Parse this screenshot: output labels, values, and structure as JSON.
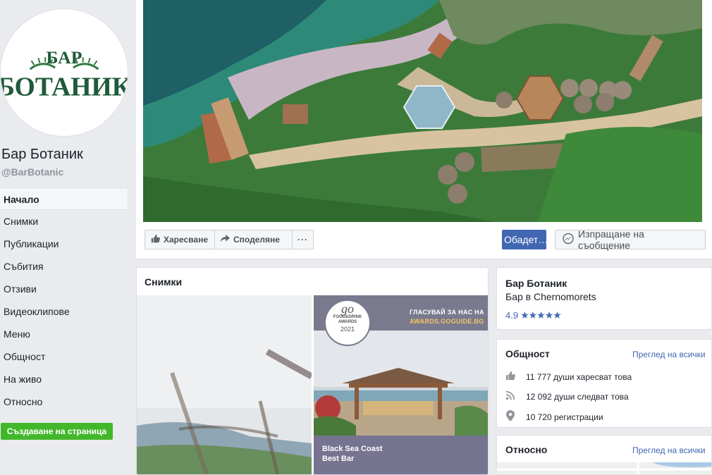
{
  "page": {
    "name": "Бар Ботаник",
    "handle": "@BarBotanic",
    "logo_text_top": "БАР",
    "logo_text_main": "БОТАНИК"
  },
  "nav": [
    {
      "label": "Начало",
      "active": true
    },
    {
      "label": "Снимки"
    },
    {
      "label": "Публикации"
    },
    {
      "label": "Събития"
    },
    {
      "label": "Отзиви"
    },
    {
      "label": "Видеоклипове"
    },
    {
      "label": "Меню"
    },
    {
      "label": "Общност"
    },
    {
      "label": "На живо"
    },
    {
      "label": "Относно"
    }
  ],
  "create_page": "Създаване на страница",
  "actions": {
    "like": "Харесване",
    "share": "Споделяне",
    "more": "···",
    "call": "Обадет…",
    "message": "Изпращане на съобщение"
  },
  "photos": {
    "title": "Снимки",
    "award": {
      "vote_line1": "ГЛАСУВАЙ ЗА НАС НА",
      "vote_line2": "AWARDS.GOGUIDE.BG",
      "badge_go": "go",
      "badge_line": "FOOD&DRINK AWARDS",
      "badge_year": "2021",
      "caption_line1": "Black Sea Coast",
      "caption_line2": "Best Bar"
    }
  },
  "info": {
    "name": "Бар Ботаник",
    "category": "Бар в Chernomorets",
    "rating": "4.9",
    "stars": "★★★★★"
  },
  "community": {
    "title": "Общност",
    "see_all": "Преглед на всички",
    "likes": "11 777 души харесват това",
    "follows": "12 092 души следват това",
    "checkins": "10 720 регистрации"
  },
  "about": {
    "title": "Относно",
    "see_all": "Преглед на всички"
  },
  "colors": {
    "brand_blue": "#4267b2",
    "create_green": "#42b72a",
    "logo_green": "#1f5a3a"
  }
}
